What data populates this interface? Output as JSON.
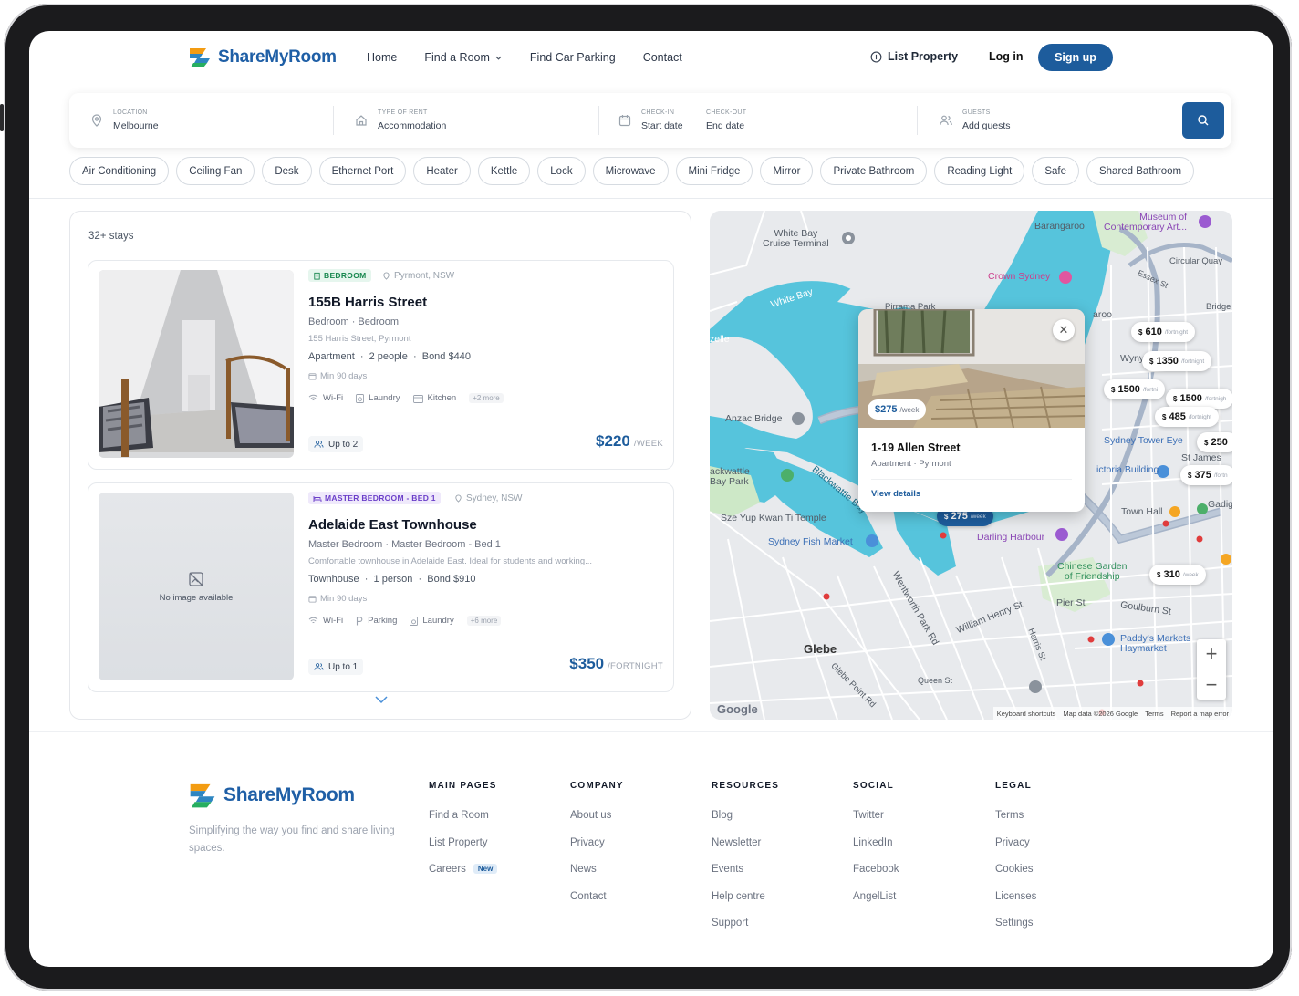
{
  "brand": {
    "name": "ShareMyRoom",
    "tagline": "Simplifying the way you find and share living spaces."
  },
  "nav": {
    "home": "Home",
    "find_room": "Find a Room",
    "car_parking": "Find Car Parking",
    "contact": "Contact"
  },
  "header": {
    "list_property": "List Property",
    "login": "Log in",
    "signup": "Sign up"
  },
  "search": {
    "location_label": "LOCATION",
    "location_value": "Melbourne",
    "rent_label": "TYPE OF RENT",
    "rent_value": "Accommodation",
    "checkin_label": "CHECK-IN",
    "checkin_value": "Start date",
    "checkout_label": "CHECK-OUT",
    "checkout_value": "End date",
    "guests_label": "GUESTS",
    "guests_value": "Add guests"
  },
  "filters": [
    "Air Conditioning",
    "Ceiling Fan",
    "Desk",
    "Ethernet Port",
    "Heater",
    "Kettle",
    "Lock",
    "Microwave",
    "Mini Fridge",
    "Mirror",
    "Private Bathroom",
    "Reading Light",
    "Safe",
    "Shared Bathroom"
  ],
  "results": {
    "count": "32+ stays",
    "listings": [
      {
        "badge": "BEDROOM",
        "location": "Pyrmont, NSW",
        "title": "155B Harris Street",
        "subtitle": "Bedroom · Bedroom",
        "address": "155 Harris Street, Pyrmont",
        "meta": "Apartment  ·  2 people  ·  Bond $440",
        "min_stay": "Min 90 days",
        "amenities": [
          "Wi-Fi",
          "Laundry",
          "Kitchen"
        ],
        "more": "+2 more",
        "capacity": "Up to 2",
        "price": "$220",
        "period": "/WEEK"
      },
      {
        "badge": "MASTER BEDROOM - BED 1",
        "location": "Sydney, NSW",
        "title": "Adelaide East Townhouse",
        "subtitle": "Master Bedroom · Master Bedroom - Bed 1",
        "address": "Comfortable townhouse in Adelaide East. Ideal for students and working...",
        "meta": "Townhouse  ·  1 person  ·  Bond $910",
        "min_stay": "Min 90 days",
        "amenities": [
          "Wi-Fi",
          "Parking",
          "Laundry"
        ],
        "more": "+6 more",
        "capacity": "Up to 1",
        "price": "$350",
        "period": "/FORTNIGHT",
        "no_image": "No image available"
      }
    ]
  },
  "map": {
    "labels": {
      "white_bay_terminal": "White Bay\nCruise Terminal",
      "white_bay": "White Bay",
      "barangaroo": "Barangaroo",
      "mca": "Museum of\nContemporary Art...",
      "circular_quay": "Circular Quay",
      "crown": "Crown Sydney",
      "pirrama": "Pirrama Park",
      "anzac": "Anzac Bridge",
      "wentworth_park_rd": "Wentworth Park Rd",
      "blackwattle": "Blackwattle Bay",
      "blackwattle_park": "ackwattle\nBay Park",
      "sze_yup": "Sze Yup Kwan Ti Temple",
      "fish_market": "Sydney Fish Market",
      "darling_harbour": "Darling Harbour",
      "chinese_garden": "Chinese Garden\nof Friendship",
      "town_hall": "Town Hall",
      "tower_eye": "Sydney Tower Eye",
      "qvb": "ictoria Building",
      "st_james": "St James",
      "paddys": "Paddy's Markets\nHaymarket",
      "glebe": "Glebe",
      "goulburn": "Goulburn St",
      "pier_st": "Pier St",
      "william_henry": "William Henry St",
      "harris_st": "Harris St",
      "gadigal": "Gadig",
      "wynyard": "Wynyar",
      "essex": "Essex St",
      "bridge": "Bridge",
      "zelle": "zelle",
      "aroo": "aroo",
      "queen_st": "Queen St",
      "glebe_point": "Glebe Point Rd"
    },
    "pins": [
      {
        "price": "610",
        "unit": "/fortnight"
      },
      {
        "price": "1350",
        "unit": "/fortnight"
      },
      {
        "price": "1500",
        "unit": "/fortni"
      },
      {
        "price": "1500",
        "unit": "/fortnigh"
      },
      {
        "price": "485",
        "unit": "/fortnight"
      },
      {
        "price": "250",
        "unit": ""
      },
      {
        "price": "375",
        "unit": "/fortn"
      },
      {
        "price": "310",
        "unit": "/week"
      },
      {
        "price": "275",
        "unit": "/week"
      }
    ],
    "pin_currency": "$",
    "popup": {
      "price": "$275",
      "period": "/week",
      "title": "1-19 Allen Street",
      "subtitle": "Apartment · Pyrmont",
      "link": "View details"
    },
    "zoom_in": "+",
    "zoom_out": "−",
    "google": "Google",
    "attribution": [
      "Keyboard shortcuts",
      "Map data ©2026 Google",
      "Terms",
      "Report a map error"
    ]
  },
  "footer": {
    "main_pages": {
      "title": "MAIN PAGES",
      "items": [
        "Find a Room",
        "List Property",
        "Careers"
      ],
      "new_badge": "New"
    },
    "company": {
      "title": "COMPANY",
      "items": [
        "About us",
        "Privacy",
        "News",
        "Contact"
      ]
    },
    "resources": {
      "title": "RESOURCES",
      "items": [
        "Blog",
        "Newsletter",
        "Events",
        "Help centre",
        "Support"
      ]
    },
    "social": {
      "title": "SOCIAL",
      "items": [
        "Twitter",
        "LinkedIn",
        "Facebook",
        "AngelList"
      ]
    },
    "legal": {
      "title": "LEGAL",
      "items": [
        "Terms",
        "Privacy",
        "Cookies",
        "Licenses",
        "Settings"
      ]
    }
  },
  "colors": {
    "primary": "#1d5c9c",
    "water": "#4fc3dc",
    "map_land": "#e9ebee"
  }
}
